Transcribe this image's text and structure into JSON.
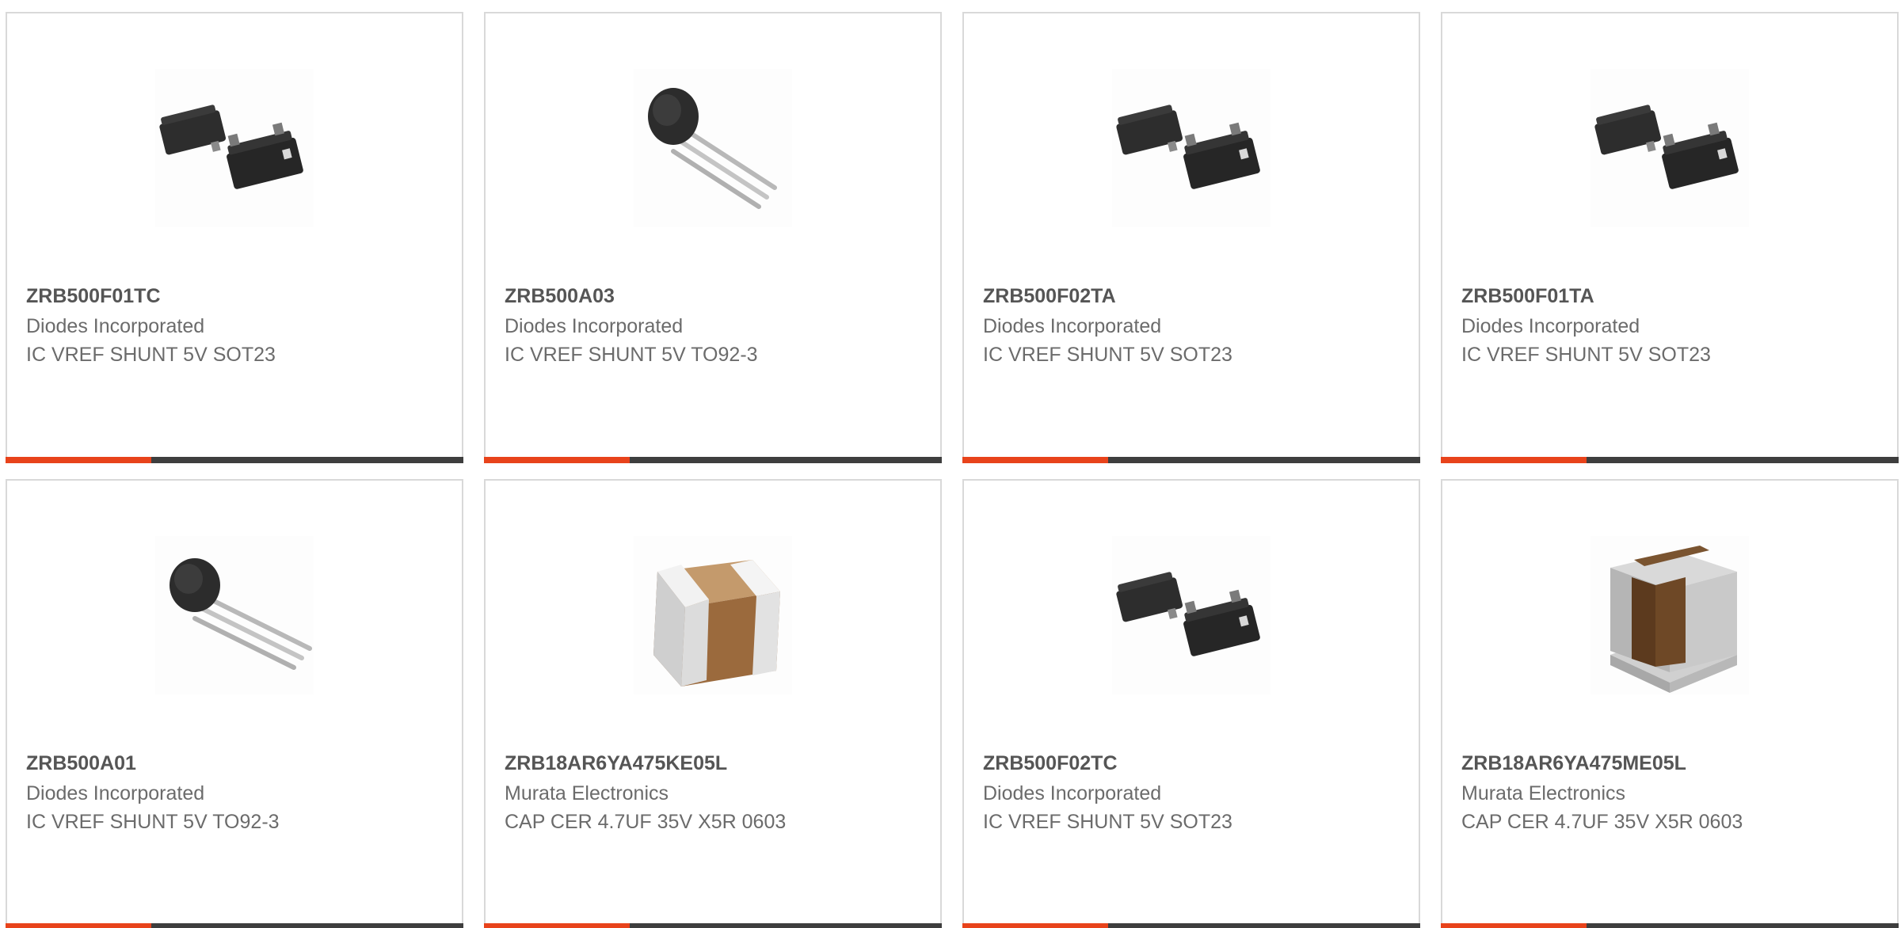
{
  "colors": {
    "accent": "#e8431b",
    "bar_dark": "#3e3e3e",
    "card_border": "#d9d9d9",
    "title_text": "#555555",
    "body_text": "#6b6b6b"
  },
  "products": [
    {
      "part_number": "ZRB500F01TC",
      "manufacturer": "Diodes Incorporated",
      "description": "IC VREF SHUNT 5V SOT23",
      "image": "sot23-package"
    },
    {
      "part_number": "ZRB500A03",
      "manufacturer": "Diodes Incorporated",
      "description": "IC VREF SHUNT 5V TO92-3",
      "image": "to92-package"
    },
    {
      "part_number": "ZRB500F02TA",
      "manufacturer": "Diodes Incorporated",
      "description": "IC VREF SHUNT 5V SOT23",
      "image": "sot23-package"
    },
    {
      "part_number": "ZRB500F01TA",
      "manufacturer": "Diodes Incorporated",
      "description": "IC VREF SHUNT 5V SOT23",
      "image": "sot23-package"
    },
    {
      "part_number": "ZRB500A01",
      "manufacturer": "Diodes Incorporated",
      "description": "IC VREF SHUNT 5V TO92-3",
      "image": "to92-package"
    },
    {
      "part_number": "ZRB18AR6YA475KE05L",
      "manufacturer": "Murata Electronics",
      "description": "CAP CER 4.7UF 35V X5R 0603",
      "image": "ceramic-capacitor-chip"
    },
    {
      "part_number": "ZRB500F02TC",
      "manufacturer": "Diodes Incorporated",
      "description": "IC VREF SHUNT 5V SOT23",
      "image": "sot23-package"
    },
    {
      "part_number": "ZRB18AR6YA475ME05L",
      "manufacturer": "Murata Electronics",
      "description": "CAP CER 4.7UF 35V X5R 0603",
      "image": "ceramic-capacitor-mounted"
    }
  ]
}
